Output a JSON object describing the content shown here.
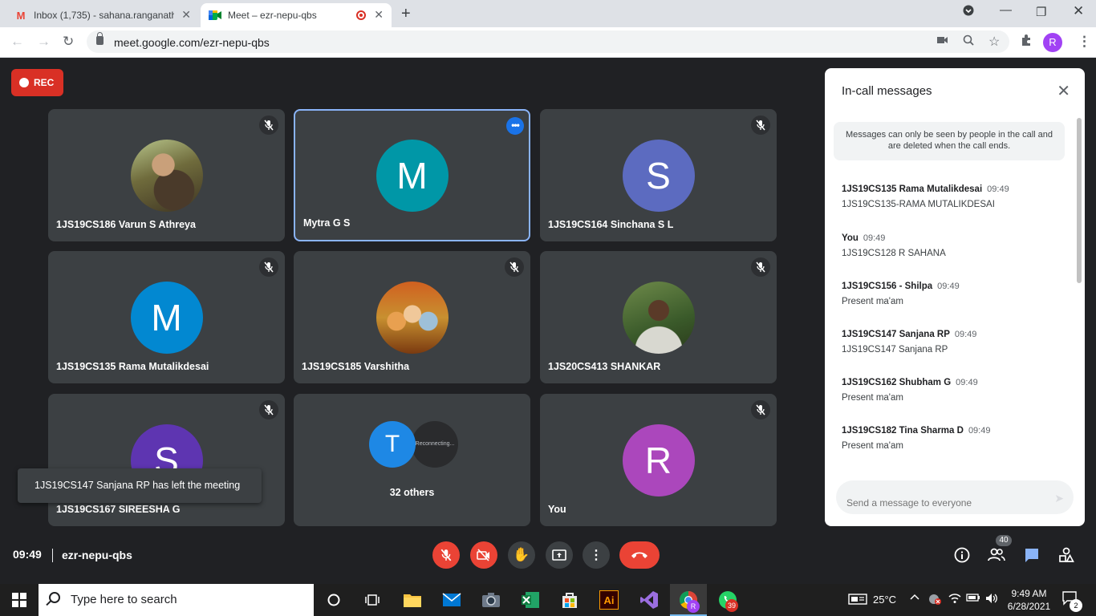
{
  "browser": {
    "tabs": [
      {
        "title": "Inbox (1,735) - sahana.ranganath",
        "icon": "gmail-icon"
      },
      {
        "title": "Meet – ezr-nepu-qbs",
        "icon": "meet-icon",
        "recording": true
      }
    ],
    "url": "meet.google.com/ezr-nepu-qbs",
    "profile_initial": "R"
  },
  "meeting": {
    "rec_label": "REC",
    "time": "09:49",
    "code": "ezr-nepu-qbs",
    "people_count": "40",
    "toast": "1JS19CS147 Sanjana RP has left the meeting"
  },
  "participants": [
    {
      "name": "1JS19CS186 Varun S Athreya",
      "avatar": "photo",
      "muted": true
    },
    {
      "name": "Mytra G S",
      "avatar_letter": "M",
      "color": "#0097a7",
      "muted": false,
      "focused": true
    },
    {
      "name": "1JS19CS164 Sinchana S L",
      "avatar_letter": "S",
      "color": "#5c6bc0",
      "muted": true
    },
    {
      "name": "1JS19CS135 Rama Mutalikdesai",
      "avatar_letter": "M",
      "color": "#0288d1",
      "muted": true
    },
    {
      "name": "1JS19CS185 Varshitha",
      "avatar": "photo",
      "muted": true
    },
    {
      "name": "1JS20CS413 SHANKAR",
      "avatar": "photo",
      "muted": true
    },
    {
      "name": "1JS19CS167 SIREESHA G",
      "avatar_letter": "S",
      "color": "#5e35b1",
      "muted": true
    },
    {
      "name": "32 others",
      "avatar_letter": "T",
      "reconnecting": "Reconnecting..."
    },
    {
      "name": "You",
      "avatar_letter": "R",
      "color": "#ab47bc",
      "muted": true
    }
  ],
  "chat": {
    "title": "In-call messages",
    "notice": "Messages can only be seen by people in the call and are deleted when the call ends.",
    "messages": [
      {
        "sender": "1JS19CS135 Rama Mutalikdesai",
        "time": "09:49",
        "text": "1JS19CS135-RAMA MUTALIKDESAI"
      },
      {
        "sender": "You",
        "time": "09:49",
        "text": "1JS19CS128 R SAHANA"
      },
      {
        "sender": "1JS19CS156 - Shilpa",
        "time": "09:49",
        "text": "Present ma'am"
      },
      {
        "sender": "1JS19CS147 Sanjana RP",
        "time": "09:49",
        "text": "1JS19CS147 Sanjana RP"
      },
      {
        "sender": "1JS19CS162 Shubham G",
        "time": "09:49",
        "text": "Present ma'am"
      },
      {
        "sender": "1JS19CS182 Tina Sharma D",
        "time": "09:49",
        "text": "Present ma'am"
      }
    ],
    "placeholder": "Send a message to everyone"
  },
  "taskbar": {
    "search_placeholder": "Type here to search",
    "chrome_badge": "R",
    "whatsapp_badge": "39",
    "temperature": "25°C",
    "time": "9:49 AM",
    "date": "6/28/2021",
    "notifications": "2"
  }
}
